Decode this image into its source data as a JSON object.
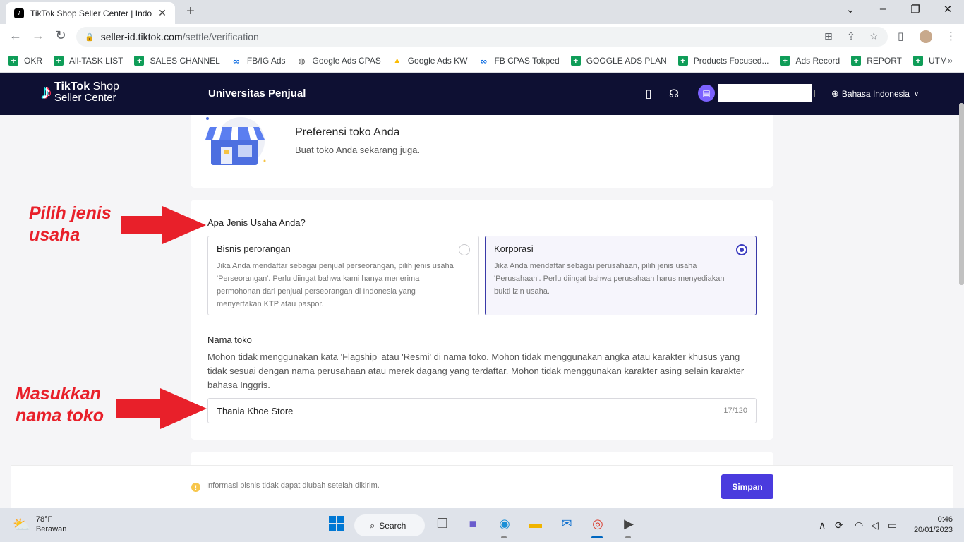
{
  "browser": {
    "tab_title": "TikTok Shop Seller Center | Indon",
    "url_host": "seller-id.tiktok.com",
    "url_path": "/settle/verification",
    "bookmarks": [
      {
        "label": "OKR",
        "icon": "sheet"
      },
      {
        "label": "All-TASK LIST",
        "icon": "sheet"
      },
      {
        "label": "SALES CHANNEL",
        "icon": "sheet"
      },
      {
        "label": "FB/IG Ads",
        "icon": "meta"
      },
      {
        "label": "Google Ads CPAS",
        "icon": "globe"
      },
      {
        "label": "Google Ads KW",
        "icon": "gads"
      },
      {
        "label": "FB CPAS Tokped",
        "icon": "meta"
      },
      {
        "label": "GOOGLE ADS PLAN",
        "icon": "sheet"
      },
      {
        "label": "Products Focused...",
        "icon": "sheet"
      },
      {
        "label": "Ads Record",
        "icon": "sheet"
      },
      {
        "label": "REPORT",
        "icon": "sheet"
      },
      {
        "label": "UTM",
        "icon": "sheet"
      }
    ]
  },
  "header": {
    "logo_line1_bold": "TikTok",
    "logo_line1_rest": " Shop",
    "logo_line2": "Seller Center",
    "university": "Universitas Penjual",
    "language": "Bahasa Indonesia"
  },
  "store_pref": {
    "title": "Preferensi toko Anda",
    "subtitle": "Buat toko Anda sekarang juga."
  },
  "business_type": {
    "question": "Apa Jenis Usaha Anda?",
    "options": [
      {
        "title": "Bisnis perorangan",
        "desc": "Jika Anda mendaftar sebagai penjual perseorangan, pilih jenis usaha 'Perseorangan'. Perlu diingat bahwa kami hanya menerima permohonan dari penjual perseorangan di Indonesia yang menyertakan KTP atau paspor.",
        "selected": false
      },
      {
        "title": "Korporasi",
        "desc": "Jika Anda mendaftar sebagai perusahaan, pilih jenis usaha 'Perusahaan'. Perlu diingat bahwa perusahaan harus menyediakan bukti izin usaha.",
        "selected": true
      }
    ]
  },
  "store_name": {
    "label": "Nama toko",
    "desc": "Mohon tidak menggunakan kata 'Flagship' atau 'Resmi' di nama toko. Mohon tidak menggunakan angka atau karakter khusus yang tidak sesuai dengan nama perusahaan atau merek dagang yang terdaftar. Mohon tidak menggunakan karakter asing selain karakter bahasa Inggris.",
    "value": "Thania Khoe Store",
    "counter": "17/120"
  },
  "annotations": {
    "a1_line1": "Pilih jenis",
    "a1_line2": "usaha",
    "a2_line1": "Masukkan",
    "a2_line2": "nama toko",
    "color": "#e8202a"
  },
  "footer": {
    "notice": "Informasi bisnis tidak dapat diubah setelah dikirim.",
    "save_label": "Simpan"
  },
  "taskbar": {
    "temp": "78°F",
    "weather": "Berawan",
    "search": "Search",
    "time": "0:46",
    "date": "20/01/2023"
  },
  "colors": {
    "header_bg": "#0e1033",
    "primary": "#4a3bde"
  }
}
